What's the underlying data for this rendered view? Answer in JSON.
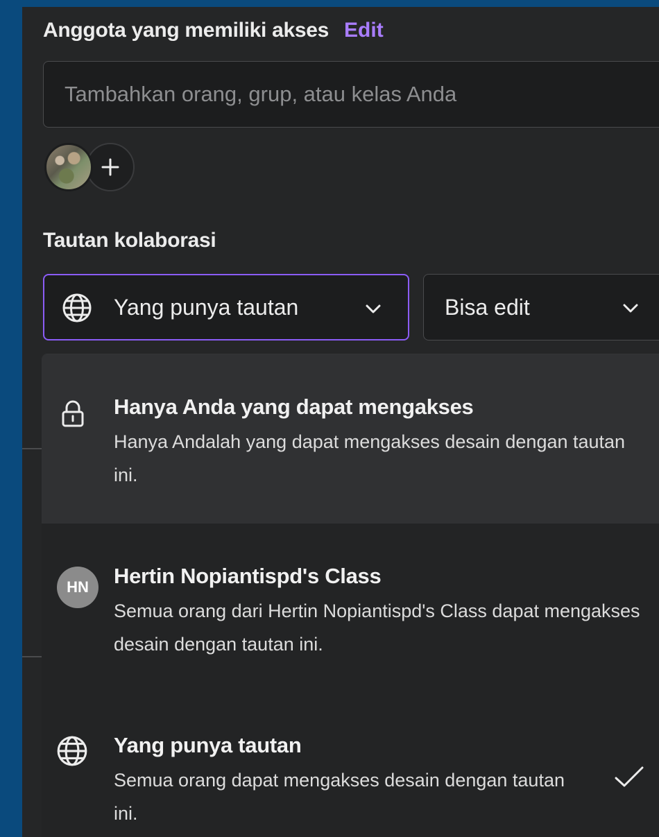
{
  "members": {
    "heading": "Anggota yang memiliki akses",
    "edit_label": "Edit",
    "search_placeholder": "Tambahkan orang, grup, atau kelas Anda"
  },
  "collab": {
    "heading": "Tautan kolaborasi",
    "access_dropdown": {
      "icon": "globe-icon",
      "value": "Yang punya tautan"
    },
    "permission_dropdown": {
      "value": "Bisa edit"
    }
  },
  "menu": {
    "items": [
      {
        "icon": "lock-icon",
        "title": "Hanya Anda yang dapat mengakses",
        "desc": "Hanya Andalah yang dapat mengakses desain dengan tautan ini."
      },
      {
        "icon": "hn-avatar",
        "avatar_initials": "HN",
        "title": "Hertin Nopiantispd's Class",
        "desc": "Semua orang dari Hertin Nopiantispd's Class dapat mengakses desain dengan tautan ini."
      },
      {
        "icon": "globe-icon",
        "title": "Yang punya tautan",
        "desc": "Semua orang dapat mengakses desain dengan tautan ini.",
        "selected": true
      }
    ]
  },
  "colors": {
    "background": "#0a4a7d",
    "panel": "#252627",
    "accent": "#8b5cf6",
    "link": "#a97dff"
  }
}
